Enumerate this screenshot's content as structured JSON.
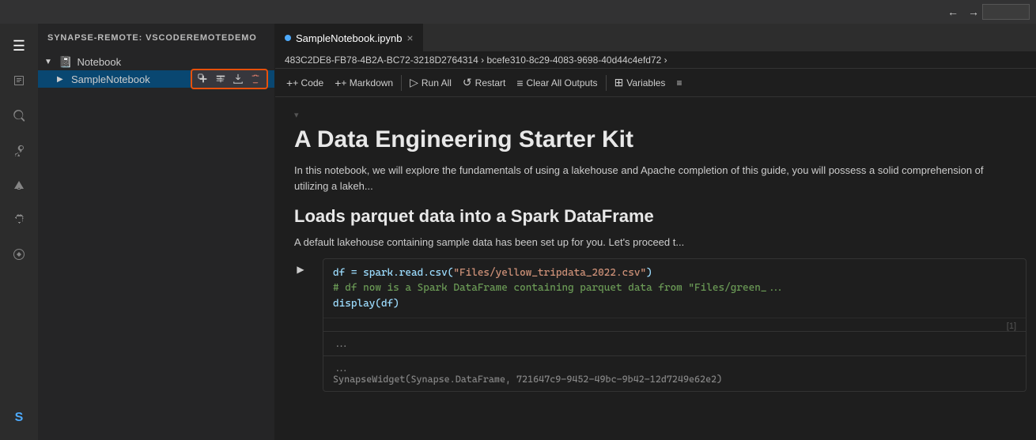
{
  "titlebar": {
    "back_label": "←",
    "forward_label": "→"
  },
  "sidebar": {
    "header": "SYNAPSE-REMOTE: VSCODEREMOTEDEMO",
    "sections": [
      {
        "label": "Notebook",
        "expanded": true,
        "items": [
          {
            "label": "SampleNotebook",
            "selected": true,
            "actions": [
              "add-cell",
              "add-markdown",
              "export",
              "delete"
            ]
          }
        ]
      }
    ]
  },
  "tab": {
    "label": "SampleNotebook.ipynb",
    "close": "×"
  },
  "breadcrumb": {
    "path": "483C2DE8-FB78-4B2A-BC72-3218D2764314 › bcefe310-8c29-4083-9698-40d44c4efd72 ›"
  },
  "toolbar": {
    "code_label": "+ Code",
    "markdown_label": "+ Markdown",
    "run_all_label": "Run All",
    "restart_label": "Restart",
    "clear_outputs_label": "Clear All Outputs",
    "variables_label": "Variables"
  },
  "notebook": {
    "title": "A Data Engineering Starter Kit",
    "intro": "In this notebook, we will explore the fundamentals of using a lakehouse and Apache completion of this guide, you will possess a solid comprehension of utilizing a lakeh...",
    "subtitle": "Loads parquet data into a Spark DataFrame",
    "description": "A default lakehouse containing sample data has been set up for you. Let's proceed t...",
    "cell_number": "[1]",
    "code_lines": [
      {
        "type": "default",
        "text": "df = spark.read.csv(",
        "string": "\"Files/yellow_tripdata_2022.csv\"",
        "end": ")"
      },
      {
        "type": "comment",
        "text": "# df now is a Spark DataFrame containing parquet data from \"Files/green_..."
      },
      {
        "type": "default",
        "text": "display(df)"
      }
    ],
    "output_dots1": "...",
    "output_dots2": "...",
    "output_widget": "SynapseWidget(Synapse.DataFrame, 721647c9-9452-49bc-9b42-12d7249e62e2)"
  },
  "icons": {
    "menu": "☰",
    "explorer": "📄",
    "search": "🔍",
    "source_control": "⑂",
    "deploy": "➤",
    "extensions": "⊞",
    "remote": "⊟",
    "synapse": "S",
    "chevron_down": "▼",
    "chevron_right": "▶",
    "notebook_icon": "📓",
    "run": "▶"
  },
  "colors": {
    "accent_orange": "#e8500a",
    "selected_bg": "#094771",
    "tab_indicator": "#4daafc"
  }
}
